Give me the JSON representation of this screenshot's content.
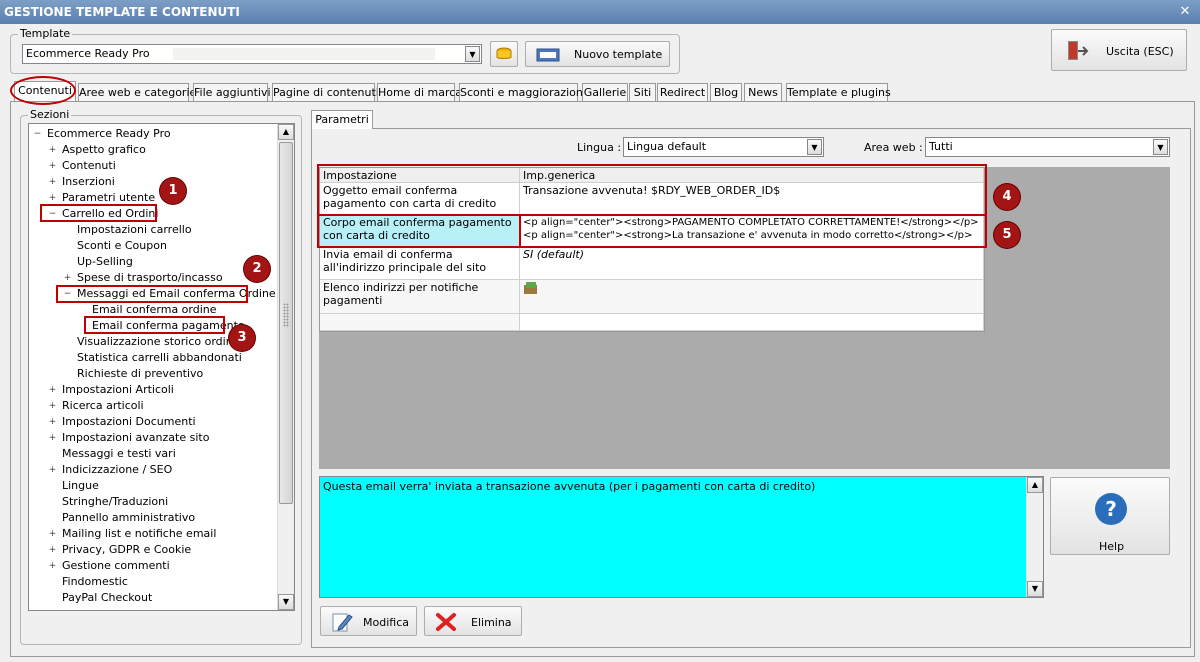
{
  "window": {
    "title": "GESTIONE TEMPLATE E CONTENUTI",
    "close": "✕"
  },
  "template": {
    "group_label": "Template",
    "selected": "Ecommerce Ready Pro",
    "new_button": "Nuovo template",
    "exit_button": "Uscita (ESC)"
  },
  "tabs": [
    "Contenuti",
    "Aree web e categorie",
    "File aggiuntivi",
    "Pagine di contenuti",
    "Home di marca",
    "Sconti e maggiorazioni",
    "Gallerie",
    "Siti",
    "Redirect",
    "Blog",
    "News",
    "Template e plugins"
  ],
  "active_tab": "Contenuti",
  "sections": {
    "group_label": "Sezioni",
    "tree": [
      {
        "label": "Ecommerce Ready Pro",
        "level": 0,
        "exp": "−"
      },
      {
        "label": "Aspetto grafico",
        "level": 1,
        "exp": "+"
      },
      {
        "label": "Contenuti",
        "level": 1,
        "exp": "+"
      },
      {
        "label": "Inserzioni",
        "level": 1,
        "exp": "+"
      },
      {
        "label": "Parametri utente",
        "level": 1,
        "exp": "+"
      },
      {
        "label": "Carrello ed Ordini",
        "level": 1,
        "exp": "−"
      },
      {
        "label": "Impostazioni carrello",
        "level": 2,
        "exp": ""
      },
      {
        "label": "Sconti e Coupon",
        "level": 2,
        "exp": ""
      },
      {
        "label": "Up-Selling",
        "level": 2,
        "exp": ""
      },
      {
        "label": "Spese di trasporto/incasso",
        "level": 2,
        "exp": "+"
      },
      {
        "label": "Messaggi ed Email conferma Ordine",
        "level": 2,
        "exp": "−"
      },
      {
        "label": "Email conferma ordine",
        "level": 3,
        "exp": ""
      },
      {
        "label": "Email conferma pagamento",
        "level": 3,
        "exp": ""
      },
      {
        "label": "Visualizzazione storico ordini",
        "level": 2,
        "exp": ""
      },
      {
        "label": "Statistica carrelli abbandonati",
        "level": 2,
        "exp": ""
      },
      {
        "label": "Richieste di preventivo",
        "level": 2,
        "exp": ""
      },
      {
        "label": "Impostazioni Articoli",
        "level": 1,
        "exp": "+"
      },
      {
        "label": "Ricerca articoli",
        "level": 1,
        "exp": "+"
      },
      {
        "label": "Impostazioni Documenti",
        "level": 1,
        "exp": "+"
      },
      {
        "label": "Impostazioni avanzate sito",
        "level": 1,
        "exp": "+"
      },
      {
        "label": "Messaggi e testi vari",
        "level": 1,
        "exp": ""
      },
      {
        "label": "Indicizzazione / SEO",
        "level": 1,
        "exp": "+"
      },
      {
        "label": "Lingue",
        "level": 1,
        "exp": ""
      },
      {
        "label": "Stringhe/Traduzioni",
        "level": 1,
        "exp": ""
      },
      {
        "label": "Pannello amministrativo",
        "level": 1,
        "exp": ""
      },
      {
        "label": "Mailing list e notifiche email",
        "level": 1,
        "exp": "+"
      },
      {
        "label": "Privacy, GDPR e Cookie",
        "level": 1,
        "exp": "+"
      },
      {
        "label": "Gestione commenti",
        "level": 1,
        "exp": "+"
      },
      {
        "label": "Findomestic",
        "level": 1,
        "exp": ""
      },
      {
        "label": "PayPal Checkout",
        "level": 1,
        "exp": ""
      }
    ]
  },
  "params": {
    "tab": "Parametri",
    "lingua_label": "Lingua :",
    "lingua_value": "Lingua default",
    "area_label": "Area web :",
    "area_value": "Tutti",
    "grid": {
      "headers": [
        "Impostazione",
        "Imp.generica"
      ],
      "rows": [
        {
          "name": "Oggetto email conferma pagamento con carta di credito",
          "value": "Transazione avvenuta! $RDY_WEB_ORDER_ID$"
        },
        {
          "name": "Corpo email conferma pagamento con carta di credito",
          "value": "<p align=\"center\"><strong>PAGAMENTO COMPLETATO CORRETTAMENTE!</strong></p>\n<p align=\"center\"><strong>La transazione e' avvenuta in modo corretto</strong></p>"
        },
        {
          "name": "Invia email di conferma all'indirizzo principale del sito",
          "value": "SI (default)"
        },
        {
          "name": "Elenco indirizzi per notifiche pagamenti",
          "value": ""
        }
      ]
    },
    "description": "Questa email verra' inviata a transazione avvenuta (per i pagamenti con carta di credito)",
    "help_button": "Help",
    "modify_button": "Modifica",
    "delete_button": "Elimina"
  },
  "badges": [
    "1",
    "2",
    "3",
    "4",
    "5"
  ],
  "colors": {
    "annotation_red": "#c00000",
    "description_bg": "#00ffff",
    "selected_row": "#b8f0f8"
  }
}
